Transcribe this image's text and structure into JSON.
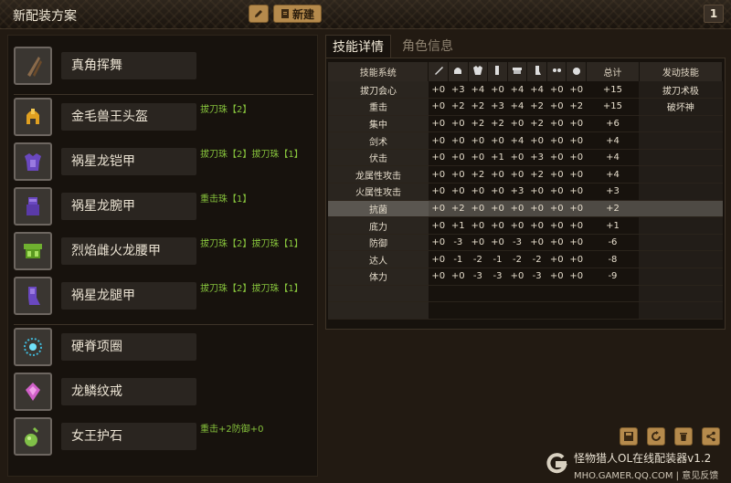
{
  "header": {
    "title": "新配装方案",
    "edit_icon": "pencil-icon",
    "new_label": "新建",
    "new_icon": "document-icon",
    "page_number": "1"
  },
  "equipment": [
    {
      "name": "真角挥舞",
      "skills": "",
      "icon": "weapon-dual-blades-icon",
      "color": "#8a6a4a"
    },
    {
      "name": "金毛兽王头盔",
      "skills": "拔刀珠【2】",
      "icon": "helmet-icon",
      "color": "#e0a020"
    },
    {
      "name": "祸星龙铠甲",
      "skills": "拔刀珠【2】拔刀珠【1】",
      "icon": "chest-armor-icon",
      "color": "#6a48c0"
    },
    {
      "name": "祸星龙腕甲",
      "skills": "重击珠【1】",
      "icon": "arm-armor-icon",
      "color": "#6a48c0"
    },
    {
      "name": "烈焰雌火龙腰甲",
      "skills": "拔刀珠【2】拔刀珠【1】",
      "icon": "waist-armor-icon",
      "color": "#70b030"
    },
    {
      "name": "祸星龙腿甲",
      "skills": "拔刀珠【2】拔刀珠【1】",
      "icon": "leg-armor-icon",
      "color": "#6a48c0"
    },
    {
      "name": "硬脊项圈",
      "skills": "",
      "icon": "necklace-icon",
      "color": "#40b8d8"
    },
    {
      "name": "龙鳞纹戒",
      "skills": "",
      "icon": "ring-icon",
      "color": "#d060c8"
    },
    {
      "name": "女王护石",
      "skills": "重击+2防御+0",
      "icon": "talisman-icon",
      "color": "#80c048"
    }
  ],
  "tabs": [
    {
      "label": "技能详情",
      "active": true
    },
    {
      "label": "角色信息",
      "active": false
    }
  ],
  "skill_table": {
    "headers": {
      "system": "技能系统",
      "total": "总计",
      "active": "发动技能",
      "slot_icons": [
        "weapon-slot-icon",
        "helmet-slot-icon",
        "chest-slot-icon",
        "arm-slot-icon",
        "waist-slot-icon",
        "leg-slot-icon",
        "jewel-slot-icon",
        "talisman-slot-icon"
      ]
    },
    "rows": [
      {
        "name": "拔刀会心",
        "vals": [
          "+0",
          "+3",
          "+4",
          "+0",
          "+4",
          "+4",
          "+0",
          "+0"
        ],
        "total": "+15",
        "active": "拔刀术极"
      },
      {
        "name": "重击",
        "vals": [
          "+0",
          "+2",
          "+2",
          "+3",
          "+4",
          "+2",
          "+0",
          "+2"
        ],
        "total": "+15",
        "active": "破坏神"
      },
      {
        "name": "集中",
        "vals": [
          "+0",
          "+0",
          "+2",
          "+2",
          "+0",
          "+2",
          "+0",
          "+0"
        ],
        "total": "+6",
        "active": ""
      },
      {
        "name": "剑术",
        "vals": [
          "+0",
          "+0",
          "+0",
          "+0",
          "+4",
          "+0",
          "+0",
          "+0"
        ],
        "total": "+4",
        "active": ""
      },
      {
        "name": "伏击",
        "vals": [
          "+0",
          "+0",
          "+0",
          "+1",
          "+0",
          "+3",
          "+0",
          "+0"
        ],
        "total": "+4",
        "active": ""
      },
      {
        "name": "龙属性攻击",
        "vals": [
          "+0",
          "+0",
          "+2",
          "+0",
          "+0",
          "+2",
          "+0",
          "+0"
        ],
        "total": "+4",
        "active": ""
      },
      {
        "name": "火属性攻击",
        "vals": [
          "+0",
          "+0",
          "+0",
          "+0",
          "+3",
          "+0",
          "+0",
          "+0"
        ],
        "total": "+3",
        "active": ""
      },
      {
        "name": "抗菌",
        "vals": [
          "+0",
          "+2",
          "+0",
          "+0",
          "+0",
          "+0",
          "+0",
          "+0"
        ],
        "total": "+2",
        "active": "",
        "highlight": true
      },
      {
        "name": "底力",
        "vals": [
          "+0",
          "+1",
          "+0",
          "+0",
          "+0",
          "+0",
          "+0",
          "+0"
        ],
        "total": "+1",
        "active": ""
      },
      {
        "name": "防御",
        "vals": [
          "+0",
          "-3",
          "+0",
          "+0",
          "-3",
          "+0",
          "+0",
          "+0"
        ],
        "total": "-6",
        "active": ""
      },
      {
        "name": "达人",
        "vals": [
          "+0",
          "-1",
          "-2",
          "-1",
          "-2",
          "-2",
          "+0",
          "+0"
        ],
        "total": "-8",
        "active": ""
      },
      {
        "name": "体力",
        "vals": [
          "+0",
          "+0",
          "-3",
          "-3",
          "+0",
          "-3",
          "+0",
          "+0"
        ],
        "total": "-9",
        "active": ""
      }
    ]
  },
  "toolbar": {
    "buttons": [
      "save-icon",
      "refresh-icon",
      "trash-icon",
      "share-icon"
    ]
  },
  "brand": {
    "title": "怪物猎人OL在线配装器v1.2",
    "url": "MHO.GAMER.QQ.COM | 意见反馈",
    "logo_icon": "g-logo-icon"
  }
}
